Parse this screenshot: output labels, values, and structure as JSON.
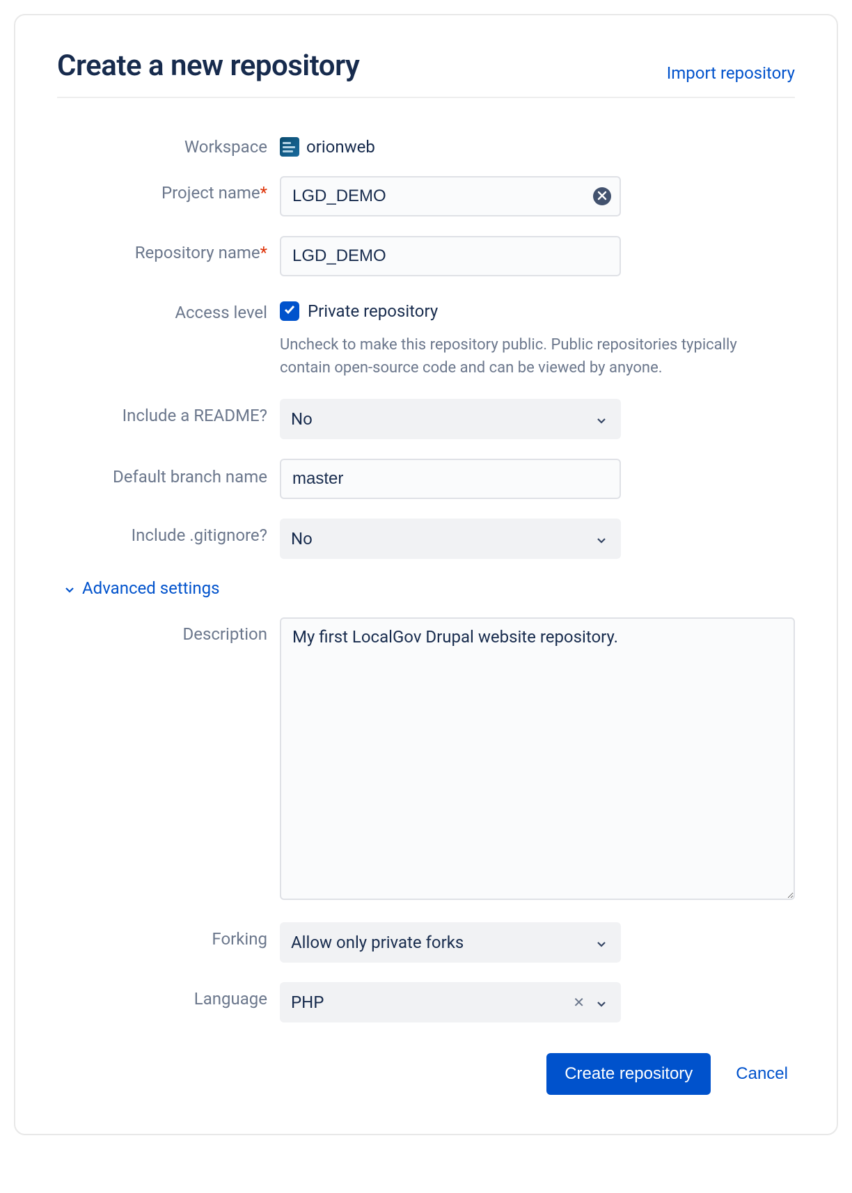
{
  "header": {
    "title": "Create a new repository",
    "import_link": "Import repository"
  },
  "form": {
    "workspace": {
      "label": "Workspace",
      "value": "orionweb"
    },
    "project_name": {
      "label": "Project name",
      "value": "LGD_DEMO"
    },
    "repository_name": {
      "label": "Repository name",
      "value": "LGD_DEMO"
    },
    "access_level": {
      "label": "Access level",
      "checkbox_label": "Private repository",
      "help": "Uncheck to make this repository public. Public repositories typically contain open-source code and can be viewed by anyone."
    },
    "include_readme": {
      "label": "Include a README?",
      "value": "No"
    },
    "default_branch": {
      "label": "Default branch name",
      "value": "master"
    },
    "include_gitignore": {
      "label": "Include .gitignore?",
      "value": "No"
    },
    "advanced_label": "Advanced settings",
    "description": {
      "label": "Description",
      "value": "My first LocalGov Drupal website repository."
    },
    "forking": {
      "label": "Forking",
      "value": "Allow only private forks"
    },
    "language": {
      "label": "Language",
      "value": "PHP"
    }
  },
  "footer": {
    "submit": "Create repository",
    "cancel": "Cancel"
  }
}
